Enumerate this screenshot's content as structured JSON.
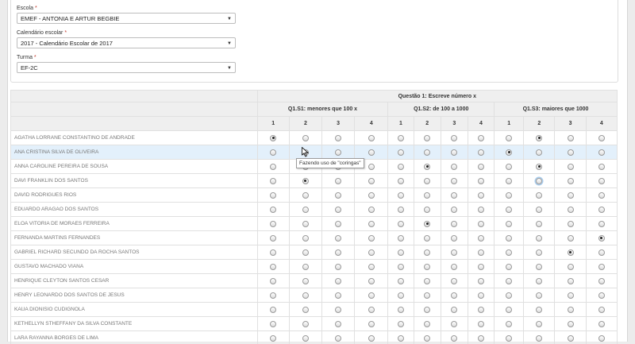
{
  "filters": {
    "escola": {
      "label": "Escola",
      "required_mark": "*",
      "value": "EMEF - ANTONIA E ARTUR BEGBIE"
    },
    "calendario": {
      "label": "Calendário escolar",
      "required_mark": "*",
      "value": "2017 - Calendário Escolar de 2017"
    },
    "turma": {
      "label": "Turma",
      "required_mark": "*",
      "value": "EF-2C"
    }
  },
  "grid": {
    "question_title": "Questão 1: Escreve número x",
    "groups": [
      {
        "label": "Q1.S1: menores que 100 x"
      },
      {
        "label": "Q1.S2: de 100 a 1000"
      },
      {
        "label": "Q1.S3: maiores que 1000"
      }
    ],
    "levels": [
      "1",
      "2",
      "3",
      "4"
    ],
    "students": [
      {
        "name": "AGATHA LORRANE CONSTANTINO DE ANDRADE",
        "selected": [
          1,
          null,
          2
        ]
      },
      {
        "name": "ANA CRISTINA SILVA DE OLIVEIRA",
        "selected": [
          2,
          null,
          1
        ],
        "highlighted": true
      },
      {
        "name": "ANNA CAROLINE PEREIRA DE SOUSA",
        "selected": [
          null,
          2,
          2
        ]
      },
      {
        "name": "DAVI FRANKLIN DOS SANTOS",
        "selected": [
          2,
          null,
          null
        ],
        "focus": [
          2,
          2
        ]
      },
      {
        "name": "DAVID RODRIGUES RIOS",
        "selected": [
          null,
          null,
          null
        ]
      },
      {
        "name": "EDUARDO ARAGAO DOS SANTOS",
        "selected": [
          null,
          null,
          null
        ]
      },
      {
        "name": "ELOA VITORIA DE MORAES FERREIRA",
        "selected": [
          null,
          2,
          null
        ]
      },
      {
        "name": "FERNANDA MARTINS FERNANDES",
        "selected": [
          null,
          null,
          4
        ]
      },
      {
        "name": "GABRIEL RICHARD SECUNDO DA ROCHA SANTOS",
        "selected": [
          null,
          null,
          3
        ]
      },
      {
        "name": "GUSTAVO MACHADO VIANA",
        "selected": [
          null,
          null,
          null
        ]
      },
      {
        "name": "HENRIQUE CLEYTON SANTOS CESAR",
        "selected": [
          null,
          null,
          null
        ]
      },
      {
        "name": "HENRY LEONARDO DOS SANTOS DE JESUS",
        "selected": [
          null,
          null,
          null
        ]
      },
      {
        "name": "KAUA DIONISIO CUDIGNOLA",
        "selected": [
          null,
          null,
          null
        ]
      },
      {
        "name": "KETHELLYN STHEFFANY DA SILVA CONSTANTE",
        "selected": [
          null,
          null,
          null
        ]
      },
      {
        "name": "LARA RAYANNA BORGES DE LIMA",
        "selected": [
          null,
          null,
          null
        ]
      }
    ]
  },
  "tooltip": {
    "text": "Fazendo uso de \"coringas\""
  }
}
